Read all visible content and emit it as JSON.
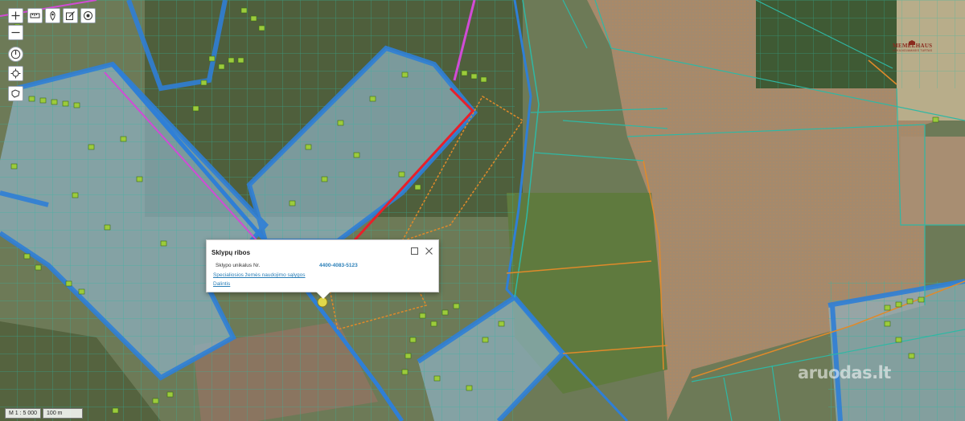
{
  "toolbar": {
    "buttons": [
      {
        "name": "zoom-in-button",
        "icon": "plus-icon"
      },
      {
        "name": "zoom-out-button",
        "icon": "minus-icon"
      },
      {
        "name": "measure-button",
        "icon": "ruler-icon"
      },
      {
        "name": "marker-button",
        "icon": "marker-icon"
      },
      {
        "name": "edit-button",
        "icon": "edit-icon"
      },
      {
        "name": "record-button",
        "icon": "target-icon"
      },
      {
        "name": "compass-button",
        "icon": "compass-icon"
      },
      {
        "name": "locate-button",
        "icon": "crosshair-icon"
      },
      {
        "name": "lasso-button",
        "icon": "lasso-icon"
      }
    ]
  },
  "popup": {
    "title": "Sklypų ribos",
    "field_label": "Sklypo unikalus Nr.",
    "field_value": "4400-4083-5123",
    "link_conditions": "Specialiosios žemės naudojimo sąlygos",
    "link_parts": "Dalintis",
    "maximize_icon": "maximize-icon",
    "close_icon": "close-icon"
  },
  "scale": {
    "ratio": "M 1 : 5 000",
    "distance": "100 m"
  },
  "logo": {
    "name": "MEMELHAUS",
    "subtitle": "NEKILNOJAMASIS TURTAS"
  },
  "watermark": {
    "text": "aruodas.lt"
  },
  "colors": {
    "highlight_blue": "#2f7fd6",
    "parcel_line": "#2fb8a4",
    "selected_parcel": "#e8202a",
    "boundary_pink": "#d14bd6",
    "orange_line": "#e08a2a",
    "field_brown": "#a78a6c"
  }
}
